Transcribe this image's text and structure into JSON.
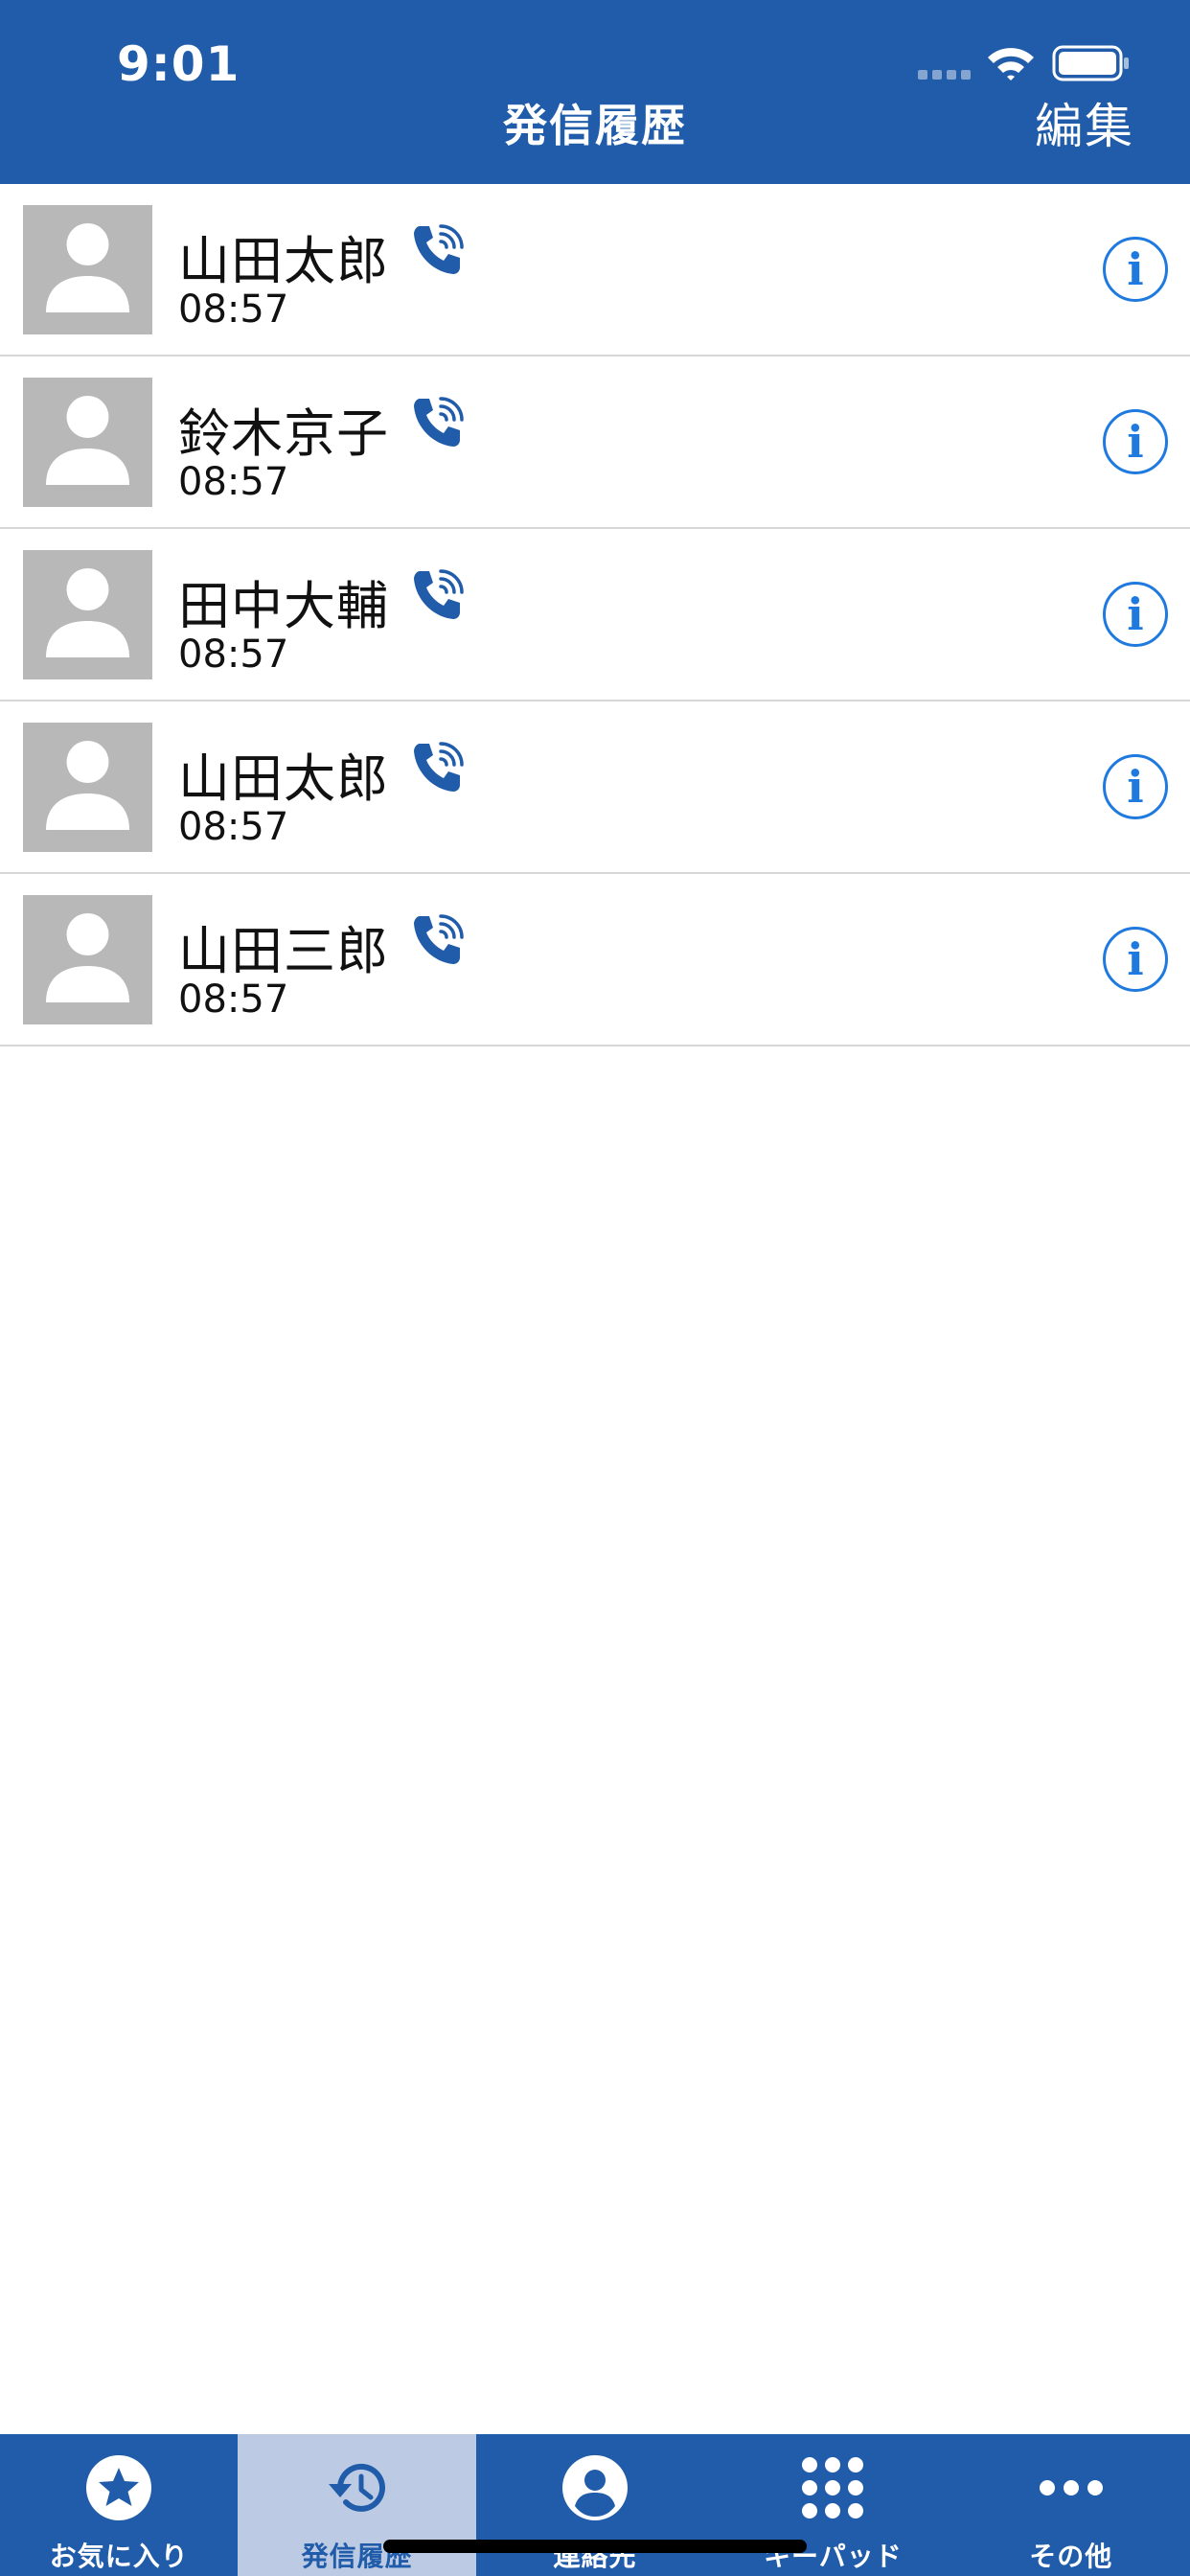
{
  "status_bar": {
    "time": "9:01"
  },
  "nav": {
    "title": "発信履歴",
    "edit_label": "編集"
  },
  "calls": [
    {
      "name": "山田太郎",
      "time": "08:57"
    },
    {
      "name": "鈴木京子",
      "time": "08:57"
    },
    {
      "name": "田中大輔",
      "time": "08:57"
    },
    {
      "name": "山田太郎",
      "time": "08:57"
    },
    {
      "name": "山田三郎",
      "time": "08:57"
    }
  ],
  "tabs": [
    {
      "label": "お気に入り",
      "icon": "star-icon",
      "active": false
    },
    {
      "label": "発信履歴",
      "icon": "history-icon",
      "active": true
    },
    {
      "label": "連絡先",
      "icon": "contact-icon",
      "active": false
    },
    {
      "label": "キーパッド",
      "icon": "keypad-icon",
      "active": false
    },
    {
      "label": "その他",
      "icon": "more-icon",
      "active": false
    }
  ],
  "colors": {
    "header": "#205ca9",
    "tab_active_bg": "#bccbe3",
    "info_blue": "#1f7ae0",
    "avatar_gray": "#b8b8b8"
  }
}
